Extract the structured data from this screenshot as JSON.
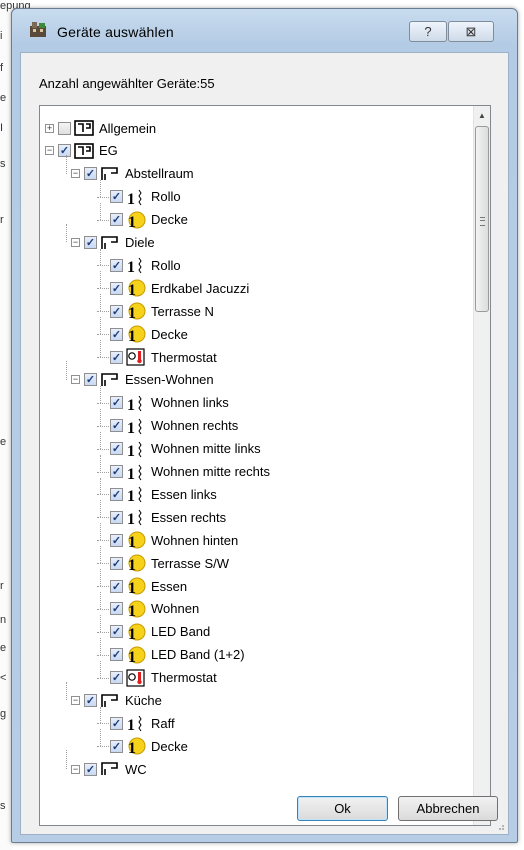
{
  "background": {
    "fragments": [
      "epung",
      "i",
      "f",
      "e",
      "I",
      "s",
      "r",
      "e",
      "r",
      "n",
      "e",
      "<",
      "g",
      "s"
    ]
  },
  "window": {
    "title": "Geräte auswählen",
    "help_label": "?",
    "close_label": "⊠",
    "accent": "#b7cde5"
  },
  "count_label": "Anzahl angewählter Geräte:55",
  "tree": {
    "nodes": [
      {
        "label": "Allgemein",
        "level": 0,
        "expander": "+",
        "checked": false,
        "icon": "room-group-icon"
      },
      {
        "label": "EG",
        "level": 0,
        "expander": "-",
        "checked": true,
        "icon": "room-group-icon"
      },
      {
        "label": "Abstellraum",
        "level": 1,
        "expander": "-",
        "checked": true,
        "icon": "room-icon"
      },
      {
        "label": "Rollo",
        "level": 2,
        "checked": true,
        "icon": "shutter-icon"
      },
      {
        "label": "Decke",
        "level": 2,
        "checked": true,
        "icon": "light-icon"
      },
      {
        "label": "Diele",
        "level": 1,
        "expander": "-",
        "checked": true,
        "icon": "room-icon"
      },
      {
        "label": "Rollo",
        "level": 2,
        "checked": true,
        "icon": "shutter-icon"
      },
      {
        "label": "Erdkabel Jacuzzi",
        "level": 2,
        "checked": true,
        "icon": "light-icon"
      },
      {
        "label": "Terrasse N",
        "level": 2,
        "checked": true,
        "icon": "light-icon"
      },
      {
        "label": "Decke",
        "level": 2,
        "checked": true,
        "icon": "light-icon"
      },
      {
        "label": "Thermostat",
        "level": 2,
        "checked": true,
        "icon": "thermostat-icon"
      },
      {
        "label": "Essen-Wohnen",
        "level": 1,
        "expander": "-",
        "checked": true,
        "icon": "room-icon"
      },
      {
        "label": "Wohnen links",
        "level": 2,
        "checked": true,
        "icon": "shutter-icon"
      },
      {
        "label": "Wohnen rechts",
        "level": 2,
        "checked": true,
        "icon": "shutter-icon"
      },
      {
        "label": "Wohnen mitte  links",
        "level": 2,
        "checked": true,
        "icon": "shutter-icon"
      },
      {
        "label": "Wohnen mitte rechts",
        "level": 2,
        "checked": true,
        "icon": "shutter-icon"
      },
      {
        "label": "Essen links",
        "level": 2,
        "checked": true,
        "icon": "shutter-icon"
      },
      {
        "label": "Essen rechts",
        "level": 2,
        "checked": true,
        "icon": "shutter-icon"
      },
      {
        "label": "Wohnen hinten",
        "level": 2,
        "checked": true,
        "icon": "light-icon"
      },
      {
        "label": "Terrasse S/W",
        "level": 2,
        "checked": true,
        "icon": "light-icon"
      },
      {
        "label": "Essen",
        "level": 2,
        "checked": true,
        "icon": "light-icon"
      },
      {
        "label": "Wohnen",
        "level": 2,
        "checked": true,
        "icon": "light-icon"
      },
      {
        "label": "LED Band",
        "level": 2,
        "checked": true,
        "icon": "light-icon"
      },
      {
        "label": "LED Band  (1+2)",
        "level": 2,
        "checked": true,
        "icon": "light-icon"
      },
      {
        "label": "Thermostat",
        "level": 2,
        "checked": true,
        "icon": "thermostat-icon"
      },
      {
        "label": "Küche",
        "level": 1,
        "expander": "-",
        "checked": true,
        "icon": "room-icon"
      },
      {
        "label": "Raff",
        "level": 2,
        "checked": true,
        "icon": "shutter-icon"
      },
      {
        "label": "Decke",
        "level": 2,
        "checked": true,
        "icon": "light-icon"
      },
      {
        "label": "WC",
        "level": 1,
        "expander": "-",
        "checked": true,
        "icon": "room-icon"
      }
    ]
  },
  "buttons": {
    "ok": "Ok",
    "cancel": "Abbrechen"
  }
}
